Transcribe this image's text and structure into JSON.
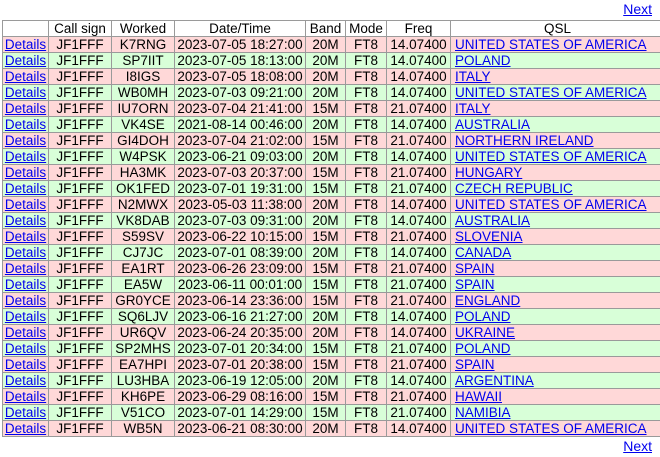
{
  "nav": {
    "next_label": "Next"
  },
  "columns": [
    "",
    "Call sign",
    "Worked",
    "Date/Time",
    "Band",
    "Mode",
    "Freq",
    "QSL"
  ],
  "details_label": "Details",
  "rows": [
    {
      "call": "JF1FFF",
      "worked": "K7RNG",
      "datetime": "2023-07-05 18:27:00",
      "band": "20M",
      "mode": "FT8",
      "freq": "14.07400",
      "qsl": "UNITED STATES OF AMERICA",
      "color": "pink"
    },
    {
      "call": "JF1FFF",
      "worked": "SP7IIT",
      "datetime": "2023-07-05 18:13:00",
      "band": "20M",
      "mode": "FT8",
      "freq": "14.07400",
      "qsl": "POLAND",
      "color": "green"
    },
    {
      "call": "JF1FFF",
      "worked": "I8IGS",
      "datetime": "2023-07-05 18:08:00",
      "band": "20M",
      "mode": "FT8",
      "freq": "14.07400",
      "qsl": "ITALY",
      "color": "pink"
    },
    {
      "call": "JF1FFF",
      "worked": "WB0MH",
      "datetime": "2023-07-03 09:21:00",
      "band": "20M",
      "mode": "FT8",
      "freq": "14.07400",
      "qsl": "UNITED STATES OF AMERICA",
      "color": "green"
    },
    {
      "call": "JF1FFF",
      "worked": "IU7ORN",
      "datetime": "2023-07-04 21:41:00",
      "band": "15M",
      "mode": "FT8",
      "freq": "21.07400",
      "qsl": "ITALY",
      "color": "pink"
    },
    {
      "call": "JF1FFF",
      "worked": "VK4SE",
      "datetime": "2021-08-14 00:46:00",
      "band": "20M",
      "mode": "FT8",
      "freq": "14.07400",
      "qsl": "AUSTRALIA",
      "color": "green"
    },
    {
      "call": "JF1FFF",
      "worked": "GI4DOH",
      "datetime": "2023-07-04 21:02:00",
      "band": "15M",
      "mode": "FT8",
      "freq": "21.07400",
      "qsl": "NORTHERN IRELAND",
      "color": "pink"
    },
    {
      "call": "JF1FFF",
      "worked": "W4PSK",
      "datetime": "2023-06-21 09:03:00",
      "band": "20M",
      "mode": "FT8",
      "freq": "14.07400",
      "qsl": "UNITED STATES OF AMERICA",
      "color": "green"
    },
    {
      "call": "JF1FFF",
      "worked": "HA3MK",
      "datetime": "2023-07-03 20:37:00",
      "band": "15M",
      "mode": "FT8",
      "freq": "21.07400",
      "qsl": "HUNGARY",
      "color": "pink"
    },
    {
      "call": "JF1FFF",
      "worked": "OK1FED",
      "datetime": "2023-07-01 19:31:00",
      "band": "15M",
      "mode": "FT8",
      "freq": "21.07400",
      "qsl": "CZECH REPUBLIC",
      "color": "green"
    },
    {
      "call": "JF1FFF",
      "worked": "N2MWX",
      "datetime": "2023-05-03 11:38:00",
      "band": "20M",
      "mode": "FT8",
      "freq": "14.07400",
      "qsl": "UNITED STATES OF AMERICA",
      "color": "pink"
    },
    {
      "call": "JF1FFF",
      "worked": "VK8DAB",
      "datetime": "2023-07-03 09:31:00",
      "band": "20M",
      "mode": "FT8",
      "freq": "14.07400",
      "qsl": "AUSTRALIA",
      "color": "green"
    },
    {
      "call": "JF1FFF",
      "worked": "S59SV",
      "datetime": "2023-06-22 10:15:00",
      "band": "15M",
      "mode": "FT8",
      "freq": "21.07400",
      "qsl": "SLOVENIA",
      "color": "pink"
    },
    {
      "call": "JF1FFF",
      "worked": "CJ7JC",
      "datetime": "2023-07-01 08:39:00",
      "band": "20M",
      "mode": "FT8",
      "freq": "14.07400",
      "qsl": "CANADA",
      "color": "green"
    },
    {
      "call": "JF1FFF",
      "worked": "EA1RT",
      "datetime": "2023-06-26 23:09:00",
      "band": "15M",
      "mode": "FT8",
      "freq": "21.07400",
      "qsl": "SPAIN",
      "color": "pink"
    },
    {
      "call": "JF1FFF",
      "worked": "EA5W",
      "datetime": "2023-06-11 00:01:00",
      "band": "15M",
      "mode": "FT8",
      "freq": "21.07400",
      "qsl": "SPAIN",
      "color": "green"
    },
    {
      "call": "JF1FFF",
      "worked": "GR0YCE",
      "datetime": "2023-06-14 23:36:00",
      "band": "15M",
      "mode": "FT8",
      "freq": "21.07400",
      "qsl": "ENGLAND",
      "color": "pink"
    },
    {
      "call": "JF1FFF",
      "worked": "SQ6LJV",
      "datetime": "2023-06-16 21:27:00",
      "band": "20M",
      "mode": "FT8",
      "freq": "14.07400",
      "qsl": "POLAND",
      "color": "green"
    },
    {
      "call": "JF1FFF",
      "worked": "UR6QV",
      "datetime": "2023-06-24 20:35:00",
      "band": "20M",
      "mode": "FT8",
      "freq": "14.07400",
      "qsl": "UKRAINE",
      "color": "pink"
    },
    {
      "call": "JF1FFF",
      "worked": "SP2MHS",
      "datetime": "2023-07-01 20:34:00",
      "band": "15M",
      "mode": "FT8",
      "freq": "21.07400",
      "qsl": "POLAND",
      "color": "green"
    },
    {
      "call": "JF1FFF",
      "worked": "EA7HPI",
      "datetime": "2023-07-01 20:38:00",
      "band": "15M",
      "mode": "FT8",
      "freq": "21.07400",
      "qsl": "SPAIN",
      "color": "pink"
    },
    {
      "call": "JF1FFF",
      "worked": "LU3HBA",
      "datetime": "2023-06-19 12:05:00",
      "band": "20M",
      "mode": "FT8",
      "freq": "14.07400",
      "qsl": "ARGENTINA",
      "color": "green"
    },
    {
      "call": "JF1FFF",
      "worked": "KH6PE",
      "datetime": "2023-06-29 08:16:00",
      "band": "15M",
      "mode": "FT8",
      "freq": "21.07400",
      "qsl": "HAWAII",
      "color": "pink"
    },
    {
      "call": "JF1FFF",
      "worked": "V51CO",
      "datetime": "2023-07-01 14:29:00",
      "band": "15M",
      "mode": "FT8",
      "freq": "21.07400",
      "qsl": "NAMIBIA",
      "color": "green"
    },
    {
      "call": "JF1FFF",
      "worked": "WB5N",
      "datetime": "2023-06-21 08:30:00",
      "band": "20M",
      "mode": "FT8",
      "freq": "14.07400",
      "qsl": "UNITED STATES OF AMERICA",
      "color": "pink"
    }
  ],
  "colors": {
    "pink_row": "#ffd8d8",
    "green_row": "#d8ffd8",
    "link": "#0000ee"
  }
}
